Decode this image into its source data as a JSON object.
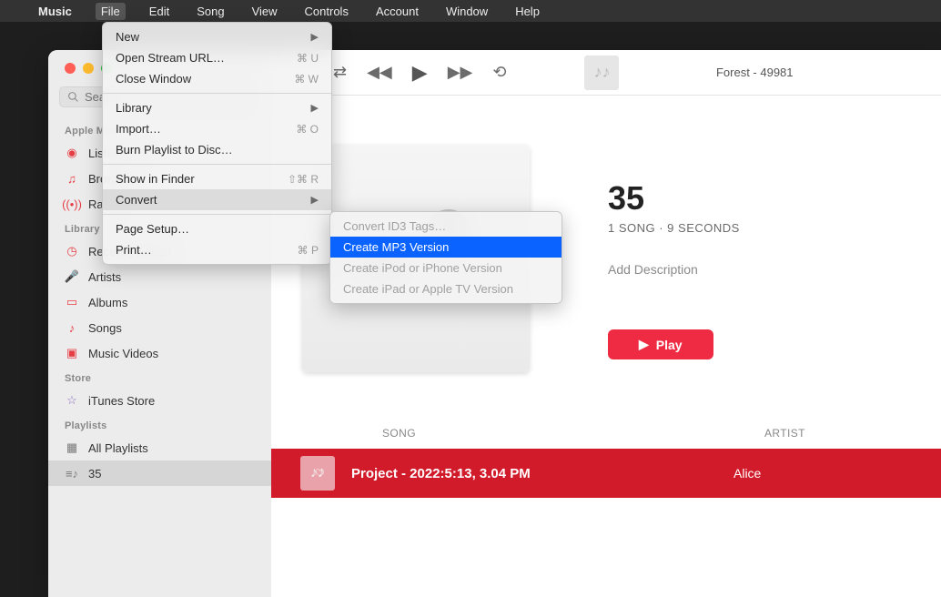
{
  "menubar": {
    "app": "Music",
    "items": [
      "File",
      "Edit",
      "Song",
      "View",
      "Controls",
      "Account",
      "Window",
      "Help"
    ],
    "active": "File"
  },
  "file_menu": {
    "items": [
      {
        "label": "New",
        "submenu": true
      },
      {
        "label": "Open Stream URL…",
        "shortcut": "⌘ U"
      },
      {
        "label": "Close Window",
        "shortcut": "⌘ W"
      },
      {
        "sep": true
      },
      {
        "label": "Library",
        "submenu": true
      },
      {
        "label": "Import…",
        "shortcut": "⌘ O"
      },
      {
        "label": "Burn Playlist to Disc…"
      },
      {
        "sep": true
      },
      {
        "label": "Show in Finder",
        "shortcut": "⇧⌘ R"
      },
      {
        "label": "Convert",
        "submenu": true,
        "highlight": true
      },
      {
        "sep": true
      },
      {
        "label": "Page Setup…"
      },
      {
        "label": "Print…",
        "shortcut": "⌘ P"
      }
    ]
  },
  "convert_menu": {
    "items": [
      {
        "label": "Convert ID3 Tags…",
        "disabled": true
      },
      {
        "label": "Create MP3 Version",
        "selected": true
      },
      {
        "label": "Create iPod or iPhone Version",
        "disabled": true
      },
      {
        "label": "Create iPad or Apple TV Version",
        "disabled": true
      }
    ]
  },
  "search": {
    "placeholder": "Search"
  },
  "sidebar": {
    "sections": [
      {
        "label": "Apple Music",
        "items": [
          {
            "icon": "play-circle",
            "label": "Listen Now"
          },
          {
            "icon": "music-note",
            "label": "Browse"
          },
          {
            "icon": "radio",
            "label": "Radio"
          }
        ]
      },
      {
        "label": "Library",
        "items": [
          {
            "icon": "clock",
            "label": "Recently Added"
          },
          {
            "icon": "mic",
            "label": "Artists"
          },
          {
            "icon": "album",
            "label": "Albums"
          },
          {
            "icon": "note",
            "label": "Songs"
          },
          {
            "icon": "video",
            "label": "Music Videos"
          }
        ]
      },
      {
        "label": "Store",
        "items": [
          {
            "icon": "star",
            "label": "iTunes Store"
          }
        ]
      },
      {
        "label": "Playlists",
        "items": [
          {
            "icon": "grid",
            "label": "All Playlists"
          },
          {
            "icon": "list",
            "label": "35",
            "selected": true
          }
        ]
      }
    ]
  },
  "now_playing": {
    "title": "Forest - 49981"
  },
  "album": {
    "title": "35",
    "subtitle": "1 SONG · 9 SECONDS",
    "description_placeholder": "Add Description",
    "play_label": "Play"
  },
  "table": {
    "columns": {
      "song": "SONG",
      "artist": "ARTIST"
    },
    "row": {
      "song": "Project - 2022:5:13, 3.04 PM",
      "artist": "Alice"
    }
  }
}
